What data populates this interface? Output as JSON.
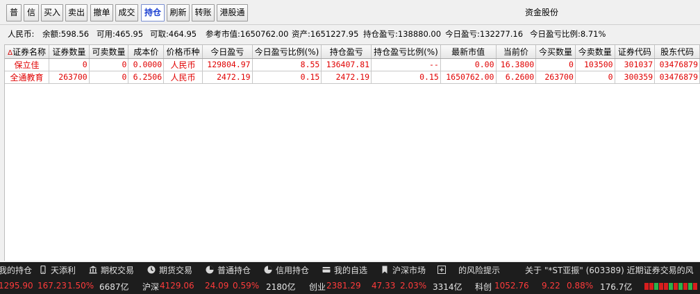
{
  "toolbar": {
    "buttons": [
      {
        "label": "普",
        "active": false
      },
      {
        "label": "信",
        "active": false
      },
      {
        "label": "买入",
        "active": false
      },
      {
        "label": "卖出",
        "active": false
      },
      {
        "label": "撤单",
        "active": false
      },
      {
        "label": "成交",
        "active": false
      },
      {
        "label": "持仓",
        "active": true
      },
      {
        "label": "刷新",
        "active": false
      },
      {
        "label": "转账",
        "active": false
      },
      {
        "label": "港股通",
        "active": false
      }
    ],
    "title": "资金股份"
  },
  "summary": {
    "currency": "人民币:",
    "balance": "余额:598.56",
    "available": "可用:465.95",
    "withdrawable": "可取:464.95",
    "market_value": "参考市值:1650762.00",
    "assets": "资产:1651227.95",
    "position_pl": "持仓盈亏:138880.00",
    "today_pl": "今日盈亏:132277.16",
    "today_pl_ratio": "今日盈亏比例:8.71%"
  },
  "table": {
    "sort_mark": "Δ",
    "headers": [
      "证券名称",
      "证券数量",
      "可卖数量",
      "成本价",
      "价格币种",
      "今日盈亏",
      "今日盈亏比例(%)",
      "持仓盈亏",
      "持仓盈亏比例(%)",
      "最新市值",
      "当前价",
      "今买数量",
      "今卖数量",
      "证券代码",
      "股东代码"
    ],
    "rows": [
      [
        "保立佳",
        "0",
        "0",
        "0.0000",
        "人民币",
        "129804.97",
        "8.55",
        "136407.81",
        "--",
        "0.00",
        "16.3800",
        "0",
        "103500",
        "301037",
        "03476879"
      ],
      [
        "全通教育",
        "263700",
        "0",
        "6.2506",
        "人民币",
        "2472.19",
        "0.15",
        "2472.19",
        "0.15",
        "1650762.00",
        "6.2600",
        "263700",
        "0",
        "300359",
        "03476879"
      ]
    ]
  },
  "nav": [
    {
      "label": "我的持仓",
      "icon": "holdings-icon"
    },
    {
      "label": "天添利",
      "icon": "phone-icon"
    },
    {
      "label": "期权交易",
      "icon": "bank-icon"
    },
    {
      "label": "期货交易",
      "icon": "clock-icon"
    },
    {
      "label": "普通持仓",
      "icon": "pie-chart-icon"
    },
    {
      "label": "信用持仓",
      "icon": "pie-chart-icon"
    },
    {
      "label": "我的自选",
      "icon": "card-icon"
    },
    {
      "label": "沪深市场",
      "icon": "bookmark-icon"
    },
    {
      "label": "",
      "icon": "plus-box-icon"
    },
    {
      "label": "的风险提示",
      "icon": ""
    },
    {
      "label": "关于 \"*ST亚振\" (603389) 近期证券交易的风",
      "icon": ""
    }
  ],
  "ticker": {
    "sh_value": "1295.90",
    "sh_change": "167.23",
    "sh_pct": "1.50%",
    "sh_amount": "6687亿",
    "hs_label": "沪深",
    "hs_value": "4129.06",
    "hs_change": "24.09",
    "hs_pct": "0.59%",
    "hs_amount": "2180亿",
    "cy_label": "创业",
    "cy_value": "2381.29",
    "cy_change": "47.33",
    "cy_pct": "2.03%",
    "cy_amount": "3314亿",
    "kc_label": "科创",
    "kc_value": "1052.76",
    "kc_change": "9.22",
    "kc_pct": "0.88%",
    "kc_amount": "176.7亿"
  },
  "colors": {
    "profit": "#e00000",
    "active_tab": "#1a3fd1",
    "status_bg": "#1d1d1d",
    "ticker_up": "#ff3b3b"
  }
}
